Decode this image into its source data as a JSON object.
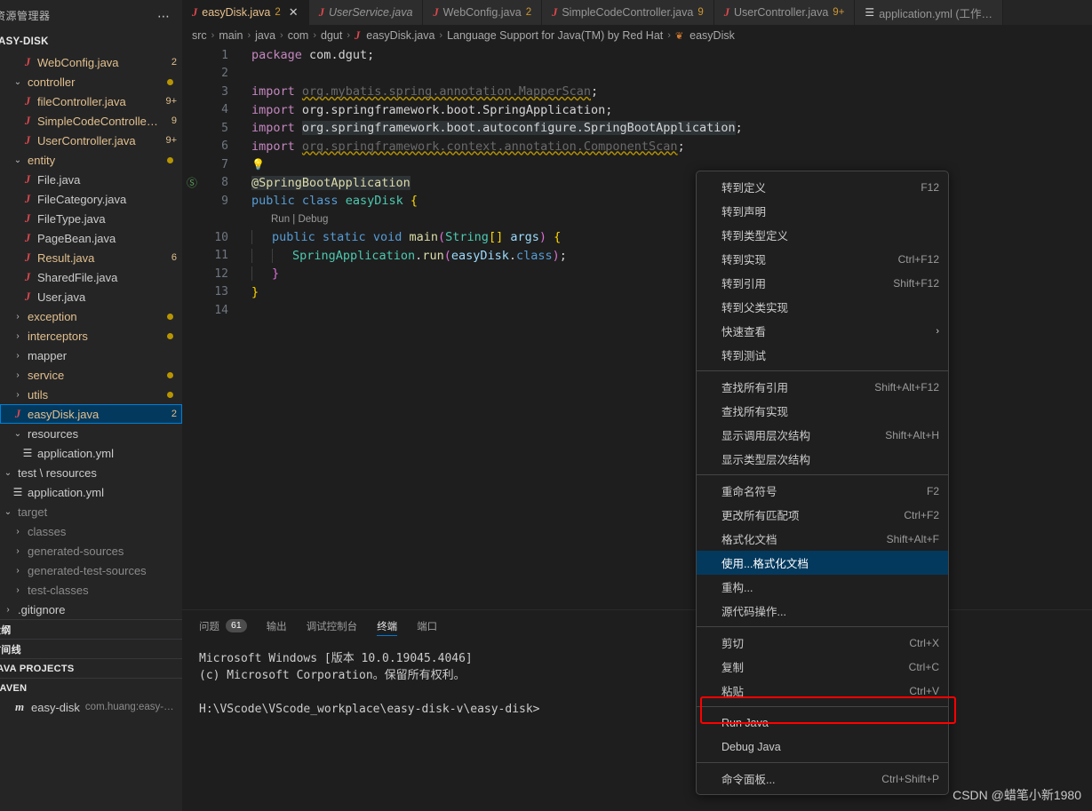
{
  "sidebar": {
    "header_title": "资源管理器",
    "more_icon": "ellipsis-icon",
    "root_folder": "EASY-DISK",
    "tree": [
      {
        "kind": "file",
        "icon": "java-file-icon",
        "label": "WebConfig.java",
        "badge": "2",
        "indent": 2,
        "color": "java"
      },
      {
        "kind": "folder",
        "icon": "chevron-down-icon",
        "label": "controller",
        "badge": "dot",
        "indent": 1,
        "color": "folder-mod"
      },
      {
        "kind": "file",
        "icon": "java-file-icon",
        "label": "fileController.java",
        "badge": "9+",
        "indent": 2,
        "color": "java"
      },
      {
        "kind": "file",
        "icon": "java-file-icon",
        "label": "SimpleCodeControlle…",
        "badge": "9",
        "indent": 2,
        "color": "java"
      },
      {
        "kind": "file",
        "icon": "java-file-icon",
        "label": "UserController.java",
        "badge": "9+",
        "indent": 2,
        "color": "java"
      },
      {
        "kind": "folder",
        "icon": "chevron-down-icon",
        "label": "entity",
        "badge": "dot",
        "indent": 1,
        "color": "folder-mod"
      },
      {
        "kind": "file",
        "icon": "java-file-icon",
        "label": "File.java",
        "badge": "",
        "indent": 2,
        "color": "plain"
      },
      {
        "kind": "file",
        "icon": "java-file-icon",
        "label": "FileCategory.java",
        "badge": "",
        "indent": 2,
        "color": "plain"
      },
      {
        "kind": "file",
        "icon": "java-file-icon",
        "label": "FileType.java",
        "badge": "",
        "indent": 2,
        "color": "plain"
      },
      {
        "kind": "file",
        "icon": "java-file-icon",
        "label": "PageBean.java",
        "badge": "",
        "indent": 2,
        "color": "plain"
      },
      {
        "kind": "file",
        "icon": "java-file-icon",
        "label": "Result.java",
        "badge": "6",
        "indent": 2,
        "color": "java"
      },
      {
        "kind": "file",
        "icon": "java-file-icon",
        "label": "SharedFile.java",
        "badge": "",
        "indent": 2,
        "color": "plain"
      },
      {
        "kind": "file",
        "icon": "java-file-icon",
        "label": "User.java",
        "badge": "",
        "indent": 2,
        "color": "plain"
      },
      {
        "kind": "folder",
        "icon": "chevron-right-icon",
        "label": "exception",
        "badge": "dot",
        "indent": 1,
        "color": "folder-mod"
      },
      {
        "kind": "folder",
        "icon": "chevron-right-icon",
        "label": "interceptors",
        "badge": "dot",
        "indent": 1,
        "color": "folder-mod"
      },
      {
        "kind": "folder",
        "icon": "chevron-right-icon",
        "label": "mapper",
        "badge": "",
        "indent": 1,
        "color": "plain"
      },
      {
        "kind": "folder",
        "icon": "chevron-right-icon",
        "label": "service",
        "badge": "dot",
        "indent": 1,
        "color": "folder-mod"
      },
      {
        "kind": "folder",
        "icon": "chevron-right-icon",
        "label": "utils",
        "badge": "dot",
        "indent": 1,
        "color": "folder-mod"
      },
      {
        "kind": "file",
        "icon": "java-file-icon",
        "label": "easyDisk.java",
        "badge": "2",
        "indent": 1,
        "color": "java",
        "selected": true
      },
      {
        "kind": "folder",
        "icon": "chevron-down-icon",
        "label": "resources",
        "badge": "",
        "indent": 1,
        "color": "plain"
      },
      {
        "kind": "yml",
        "icon": "yaml-file-icon",
        "label": "application.yml",
        "badge": "",
        "indent": 2,
        "color": "plain"
      },
      {
        "kind": "folder",
        "icon": "chevron-down-icon",
        "label": "test \\ resources",
        "badge": "",
        "indent": 0,
        "color": "plain"
      },
      {
        "kind": "yml",
        "icon": "yaml-file-icon",
        "label": "application.yml",
        "badge": "",
        "indent": 1,
        "color": "plain"
      },
      {
        "kind": "folder",
        "icon": "chevron-down-icon",
        "label": "target",
        "badge": "",
        "indent": 0,
        "color": "dim"
      },
      {
        "kind": "folder",
        "icon": "chevron-right-icon",
        "label": "classes",
        "badge": "",
        "indent": 1,
        "color": "dim"
      },
      {
        "kind": "folder",
        "icon": "chevron-right-icon",
        "label": "generated-sources",
        "badge": "",
        "indent": 1,
        "color": "dim"
      },
      {
        "kind": "folder",
        "icon": "chevron-right-icon",
        "label": "generated-test-sources",
        "badge": "",
        "indent": 1,
        "color": "dim"
      },
      {
        "kind": "folder",
        "icon": "chevron-right-icon",
        "label": "test-classes",
        "badge": "",
        "indent": 1,
        "color": "dim"
      },
      {
        "kind": "folder",
        "icon": "chevron-right-icon",
        "label": ".gitignore",
        "badge": "",
        "indent": 0,
        "color": "plain"
      }
    ],
    "sections": [
      {
        "label": "大纲"
      },
      {
        "label": "时间线"
      },
      {
        "label": "JAVA PROJECTS"
      },
      {
        "label": "MAVEN"
      }
    ],
    "maven_item": {
      "icon": "maven-icon",
      "label": "easy-disk",
      "detail": "com.huang:easy-…"
    }
  },
  "tabs": [
    {
      "icon": "java-file-icon",
      "label": "easyDisk.java",
      "count": "2",
      "active": true,
      "dirty": false,
      "closable": true,
      "close_icon": "close-icon"
    },
    {
      "icon": "java-file-icon",
      "label": "UserService.java",
      "count": "",
      "active": false,
      "dirty": true,
      "closable": false
    },
    {
      "icon": "java-file-icon",
      "label": "WebConfig.java",
      "count": "2",
      "active": false,
      "dirty": false,
      "closable": false
    },
    {
      "icon": "java-file-icon",
      "label": "SimpleCodeController.java",
      "count": "9",
      "active": false,
      "dirty": false,
      "closable": false
    },
    {
      "icon": "java-file-icon",
      "label": "UserController.java",
      "count": "9+",
      "active": false,
      "dirty": false,
      "closable": false
    },
    {
      "icon": "yaml-file-icon",
      "label": "application.yml (工作…",
      "count": "",
      "active": false,
      "dirty": false,
      "closable": false
    }
  ],
  "breadcrumb": [
    {
      "label": "src",
      "icon": ""
    },
    {
      "label": "main",
      "icon": ""
    },
    {
      "label": "java",
      "icon": ""
    },
    {
      "label": "com",
      "icon": ""
    },
    {
      "label": "dgut",
      "icon": ""
    },
    {
      "label": "easyDisk.java",
      "icon": "java-file-icon"
    },
    {
      "label": "Language Support for Java(TM) by Red Hat",
      "icon": ""
    },
    {
      "label": "easyDisk",
      "icon": "class-icon"
    }
  ],
  "editor": {
    "code_lens": "Run | Debug",
    "lines": [
      {
        "n": "1",
        "text": "package com.dgut;"
      },
      {
        "n": "2",
        "text": ""
      },
      {
        "n": "3",
        "text": "import org.mybatis.spring.annotation.MapperScan;"
      },
      {
        "n": "4",
        "text": "import org.springframework.boot.SpringApplication;"
      },
      {
        "n": "5",
        "text": "import org.springframework.boot.autoconfigure.SpringBootApplication;"
      },
      {
        "n": "6",
        "text": "import org.springframework.context.annotation.ComponentScan;"
      },
      {
        "n": "7",
        "text": ""
      },
      {
        "n": "8",
        "text": "@SpringBootApplication"
      },
      {
        "n": "9",
        "text": "public class easyDisk {"
      },
      {
        "n": "10",
        "text": "    public static void main(String[] args) {"
      },
      {
        "n": "11",
        "text": "        SpringApplication.run(easyDisk.class);"
      },
      {
        "n": "12",
        "text": "    }"
      },
      {
        "n": "13",
        "text": "}"
      },
      {
        "n": "14",
        "text": ""
      }
    ]
  },
  "context_menu": {
    "items": [
      {
        "label": "转到定义",
        "key": "F12",
        "type": "item"
      },
      {
        "label": "转到声明",
        "key": "",
        "type": "item"
      },
      {
        "label": "转到类型定义",
        "key": "",
        "type": "item"
      },
      {
        "label": "转到实现",
        "key": "Ctrl+F12",
        "type": "item"
      },
      {
        "label": "转到引用",
        "key": "Shift+F12",
        "type": "item"
      },
      {
        "label": "转到父类实现",
        "key": "",
        "type": "item"
      },
      {
        "label": "快速查看",
        "key": "",
        "type": "submenu",
        "arrow_icon": "chevron-right-icon"
      },
      {
        "label": "转到测试",
        "key": "",
        "type": "item"
      },
      {
        "type": "separator"
      },
      {
        "label": "查找所有引用",
        "key": "Shift+Alt+F12",
        "type": "item"
      },
      {
        "label": "查找所有实现",
        "key": "",
        "type": "item"
      },
      {
        "label": "显示调用层次结构",
        "key": "Shift+Alt+H",
        "type": "item"
      },
      {
        "label": "显示类型层次结构",
        "key": "",
        "type": "item"
      },
      {
        "type": "separator"
      },
      {
        "label": "重命名符号",
        "key": "F2",
        "type": "item"
      },
      {
        "label": "更改所有匹配项",
        "key": "Ctrl+F2",
        "type": "item"
      },
      {
        "label": "格式化文档",
        "key": "Shift+Alt+F",
        "type": "item"
      },
      {
        "label": "使用...格式化文档",
        "key": "",
        "type": "item",
        "selected": true
      },
      {
        "label": "重构...",
        "key": "",
        "type": "item"
      },
      {
        "label": "源代码操作...",
        "key": "",
        "type": "item"
      },
      {
        "type": "separator"
      },
      {
        "label": "剪切",
        "key": "Ctrl+X",
        "type": "item"
      },
      {
        "label": "复制",
        "key": "Ctrl+C",
        "type": "item"
      },
      {
        "label": "粘贴",
        "key": "Ctrl+V",
        "type": "item"
      },
      {
        "type": "separator"
      },
      {
        "label": "Run Java",
        "key": "",
        "type": "item",
        "highlighted": true
      },
      {
        "label": "Debug Java",
        "key": "",
        "type": "item"
      },
      {
        "type": "separator"
      },
      {
        "label": "命令面板...",
        "key": "Ctrl+Shift+P",
        "type": "item"
      }
    ]
  },
  "panel": {
    "tabs": [
      {
        "label": "问题",
        "badge": "61",
        "active": false
      },
      {
        "label": "输出",
        "badge": "",
        "active": false
      },
      {
        "label": "调试控制台",
        "badge": "",
        "active": false
      },
      {
        "label": "终端",
        "badge": "",
        "active": true
      },
      {
        "label": "端口",
        "badge": "",
        "active": false
      }
    ],
    "terminal_lines": [
      "Microsoft Windows [版本 10.0.19045.4046]",
      "(c) Microsoft Corporation。保留所有权利。",
      "",
      "H:\\VScode\\VScode_workplace\\easy-disk-v\\easy-disk>"
    ]
  },
  "watermark": "CSDN @蜡笔小新1980",
  "colors": {
    "accent": "#0078d4",
    "selection": "#04395e",
    "annotation": "#ff0000",
    "java_icon": "#e0474c",
    "modified_badge": "#e2c08d",
    "folder_dot": "#b89500"
  }
}
